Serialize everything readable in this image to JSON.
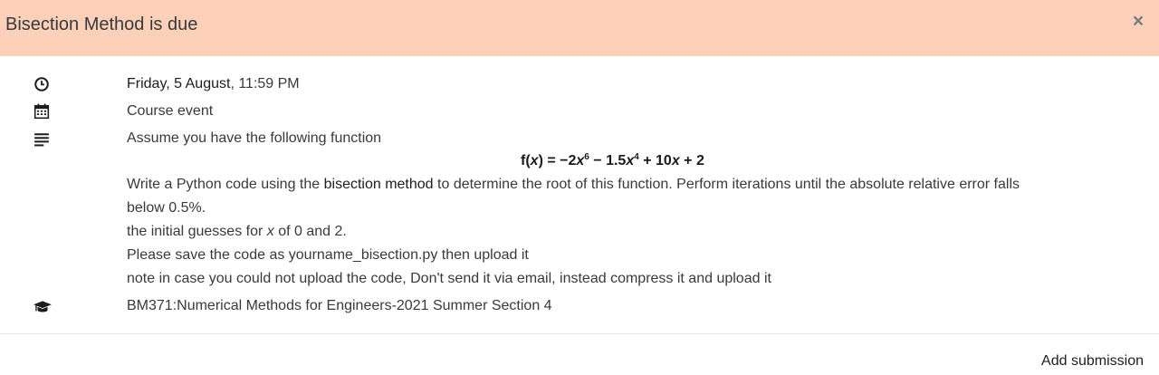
{
  "header": {
    "title": "Bisection Method is due",
    "close_glyph": "×",
    "background": "#fdd0b9"
  },
  "event": {
    "date_bold": "Friday, 5 August",
    "date_time": ", 11:59 PM",
    "type": "Course event",
    "description": {
      "intro": "Assume you have the following function",
      "formula": {
        "f": "f(",
        "x": "x",
        "eq": ") = −2",
        "x6": "x",
        "exp6": "6",
        "mid": " − 1.5",
        "x4": "x",
        "exp4": "4",
        "plus": " + 10",
        "x1": "x",
        "end": " + 2"
      },
      "p1_start": "Write a Python code using the ",
      "p1_link": "bisection method",
      "p1_end": " to determine the root of this function. Perform iterations until the absolute relative error falls",
      "p1_cont": "below 0.5%.",
      "p2_start": "the initial guesses for ",
      "p2_var": "x",
      "p2_end": " of 0 and 2.",
      "p3": "Please save the code as yourname_bisection.py then upload it",
      "p4": "note in case you could not upload the code, Don't send it via email, instead compress it and upload it"
    },
    "course": "BM371:Numerical Methods for Engineers-2021 Summer Section 4"
  },
  "footer": {
    "action_label": "Add submission"
  },
  "icons": [
    "clock-icon",
    "calendar-icon",
    "align-left-icon",
    "graduation-cap-icon",
    "close-icon"
  ]
}
